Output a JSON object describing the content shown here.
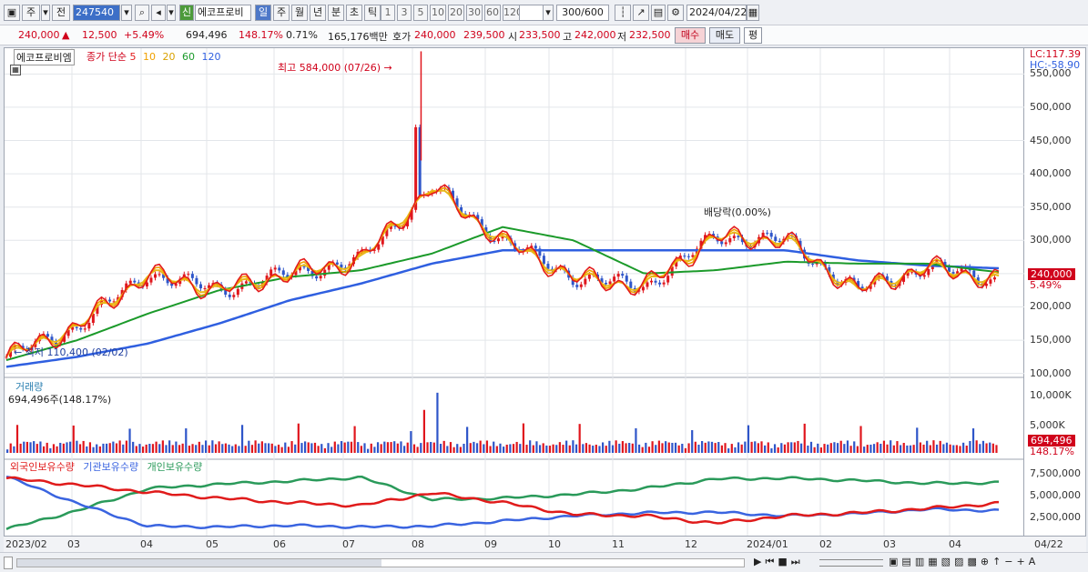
{
  "toolbar": {
    "market_label": "주",
    "prev_label": "전",
    "stock_code": "247540",
    "new_badge": "신",
    "stock_name": "에코프로비",
    "period_tabs": [
      "일",
      "주",
      "월",
      "년",
      "분",
      "초",
      "틱"
    ],
    "number_tabs": [
      "1",
      "3",
      "5",
      "10",
      "20",
      "30",
      "60",
      "120"
    ],
    "count_value": "300",
    "count_total": "/600",
    "date_value": "2024/04/22"
  },
  "quote": {
    "price": "240,000",
    "change": "12,500",
    "change_pct": "+5.49%",
    "volume": "694,496",
    "volume_ratio": "148.17%",
    "turnover": "0.71%",
    "amount": "165,176백만",
    "ask_label": "호가",
    "ask": "240,000",
    "bid": "239,500",
    "open_label": "시",
    "open": "233,500",
    "high_label": "고",
    "high": "242,000",
    "low_label": "저",
    "low": "232,500",
    "buy_button": "매수",
    "sell_button": "매도",
    "eval_button": "평"
  },
  "legend": {
    "name": "에코프로비엠",
    "ma_title": "종가 단순",
    "ma_periods": [
      "5",
      "10",
      "20",
      "60",
      "120"
    ],
    "volume_title": "거래량",
    "volume_value": "694,496주(148.17%)",
    "holders": [
      "외국인보유수량",
      "기관보유수량",
      "개인보유수량"
    ]
  },
  "annotations": {
    "high": "최고 584,000 (07/26)",
    "low": "최저 110,400 (02/02)",
    "dividend": "배당락(0.00%)"
  },
  "axis": {
    "lc": "LC:117.39",
    "hc": "HC:-58.90",
    "price_ticks": [
      "550,000",
      "500,000",
      "450,000",
      "400,000",
      "350,000",
      "300,000",
      "250,000",
      "200,000",
      "150,000",
      "100,000"
    ],
    "price_tag": "240,000",
    "pct_tag": "5.49%",
    "volume_ticks": [
      "10,000K",
      "5,000K"
    ],
    "volume_tag": "694,496",
    "volume_pct_tag": "148.17%",
    "holder_ticks": [
      "7,500,000",
      "5,000,000",
      "2,500,000"
    ]
  },
  "dates": [
    "2023/02",
    "03",
    "04",
    "05",
    "06",
    "07",
    "08",
    "09",
    "10",
    "11",
    "12",
    "2024/01",
    "02",
    "03",
    "04",
    "04/22"
  ],
  "colors": {
    "up": "#e0161d",
    "down": "#2e55c9",
    "ma5": "#e31b1b",
    "ma10": "#f0a000",
    "ma20": "#e8b81a",
    "ma60": "#1b9a2a",
    "ma120": "#2f5fe0",
    "foreign": "#e01b1b",
    "institution": "#3a64e0",
    "individual": "#2a9a5a"
  },
  "chart_data": {
    "type": "candlestick",
    "months": [
      "2023/02",
      "03",
      "04",
      "05",
      "06",
      "07",
      "08",
      "09",
      "10",
      "11",
      "12",
      "2024/01",
      "02",
      "03",
      "04"
    ],
    "close_monthly_approx": [
      125000,
      170000,
      250000,
      225000,
      250000,
      270000,
      380000,
      300000,
      245000,
      230000,
      305000,
      300000,
      225000,
      260000,
      240000
    ],
    "ma120_monthly_approx": [
      110000,
      125000,
      145000,
      175000,
      210000,
      235000,
      265000,
      285000,
      285000,
      285000,
      285000,
      285000,
      270000,
      262000,
      258000
    ],
    "ma60_monthly_approx": [
      120000,
      150000,
      190000,
      225000,
      245000,
      255000,
      280000,
      320000,
      300000,
      250000,
      255000,
      268000,
      265000,
      265000,
      252000
    ],
    "high": {
      "value": 584000,
      "date": "07/26"
    },
    "low": {
      "value": 110400,
      "date": "02/02"
    },
    "last": {
      "close": 240000,
      "change_pct": 5.49,
      "volume": 694496
    },
    "volume_peak_k": 10500,
    "foreign_holding_monthly": [
      7900000,
      7000000,
      6000000,
      5200000,
      4600000,
      4200000,
      5900000,
      4600000,
      3000000,
      2800000,
      1800000,
      2800000,
      3200000,
      3800000,
      4500000
    ],
    "institution_holding_monthly": [
      8100000,
      4500000,
      1400000,
      1300000,
      1500000,
      1300000,
      1400000,
      2100000,
      2800000,
      3200000,
      3300000,
      2800000,
      3100000,
      3700000,
      3500000
    ],
    "individual_holding_monthly": [
      1000000,
      3500000,
      6500000,
      7100000,
      7500000,
      8000000,
      5000000,
      5200000,
      5700000,
      6500000,
      7800000,
      7900000,
      7600000,
      7200000,
      7300000
    ]
  }
}
